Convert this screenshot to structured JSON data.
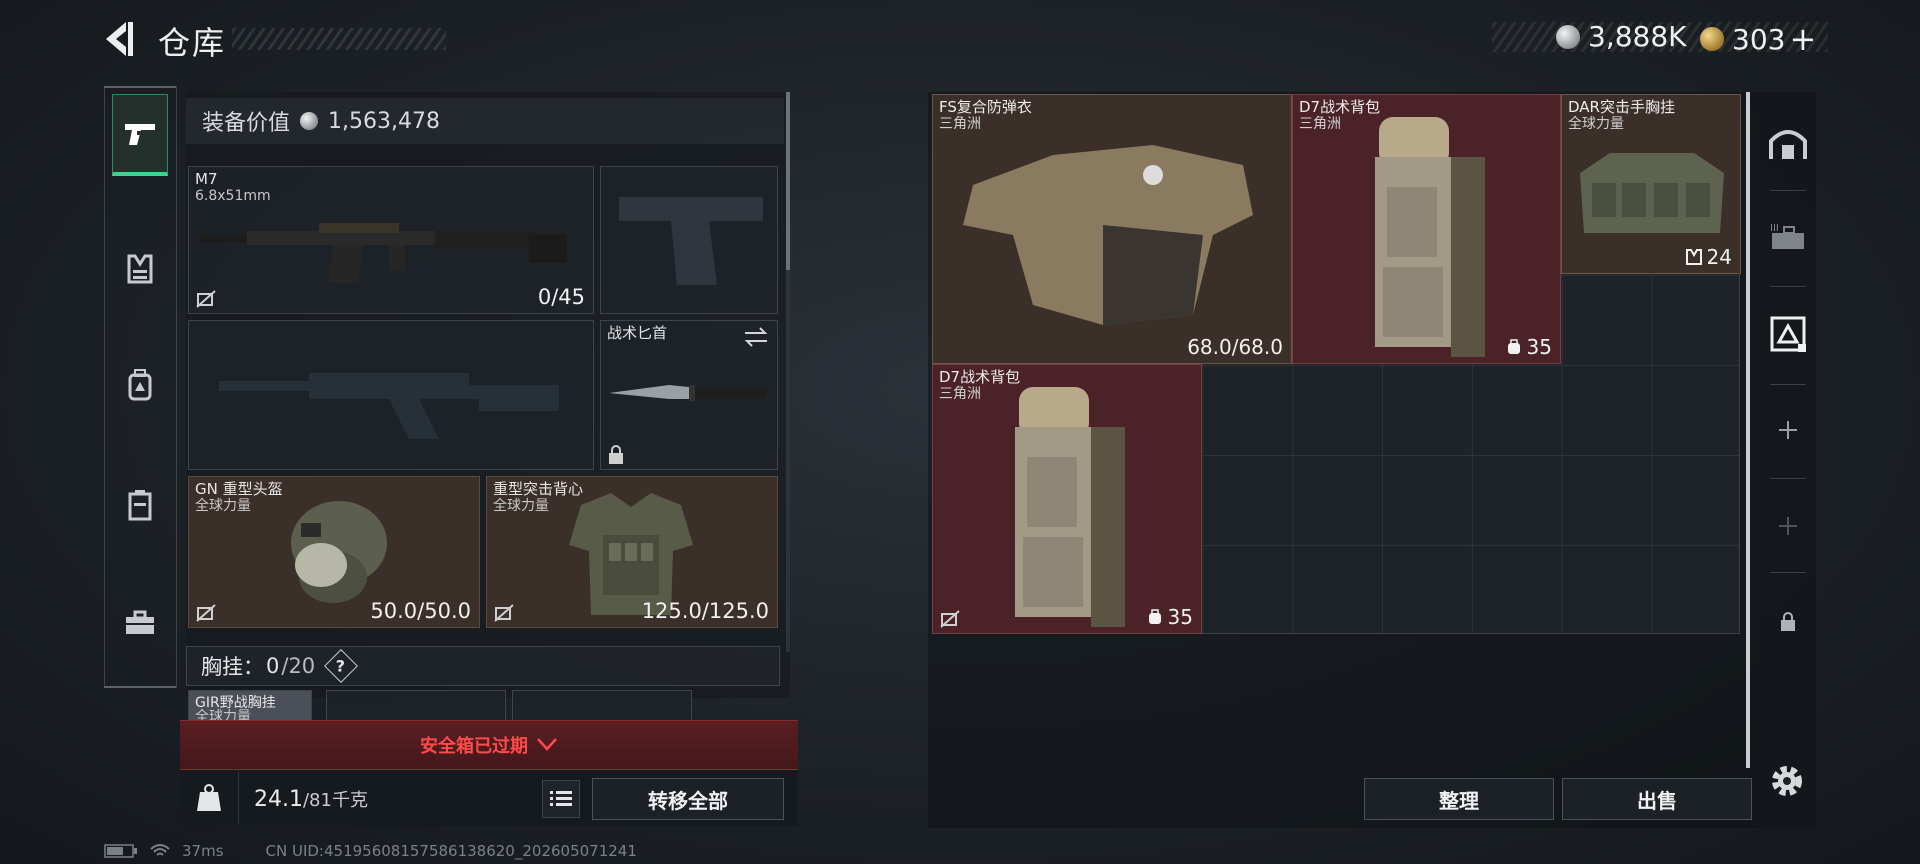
{
  "header": {
    "title": "仓库",
    "currency_silver": "3,888K",
    "currency_gold": "303",
    "gold_add": "+"
  },
  "sidebar": {
    "tabs": [
      {
        "name": "weapons",
        "icon": "pistol-icon",
        "active": true
      },
      {
        "name": "armor",
        "icon": "vest-icon"
      },
      {
        "name": "backpack",
        "icon": "backpack-icon"
      },
      {
        "name": "container",
        "icon": "case-icon"
      },
      {
        "name": "toolbox",
        "icon": "toolbox-icon"
      }
    ]
  },
  "loadout": {
    "value_label": "装备价值",
    "value": "1,563,478",
    "primary": {
      "name": "M7",
      "caliber": "6.8x51mm",
      "ammo": "0/45"
    },
    "melee": {
      "name": "战术匕首"
    },
    "helmet": {
      "name": "GN 重型头盔",
      "faction": "全球力量",
      "durability": "50.0/50.0"
    },
    "armor": {
      "name": "重型突击背心",
      "faction": "全球力量",
      "durability": "125.0/125.0"
    },
    "chest_rig": {
      "label": "胸挂：",
      "count": "0",
      "cap": "/20",
      "help": "?"
    },
    "rig_item": {
      "name": "GIR野战胸挂",
      "faction": "全球力量"
    },
    "safe_box_expired": "安全箱已过期",
    "weight": {
      "current": "24.1",
      "max": "/81千克"
    },
    "transfer_all": "转移全部"
  },
  "storage": {
    "items": [
      {
        "name": "FS复合防弹衣",
        "faction": "三角洲",
        "value": "68.0/68.0",
        "style": "brown"
      },
      {
        "name": "D7战术背包",
        "faction": "三角洲",
        "value": "35",
        "style": "red"
      },
      {
        "name": "DAR突击手胸挂",
        "faction": "全球力量",
        "value": "24",
        "style": "brown"
      },
      {
        "name": "D7战术背包",
        "faction": "三角洲",
        "value": "35",
        "style": "red"
      }
    ],
    "sort_button": "整理",
    "sell_button": "出售"
  },
  "status_bar": {
    "ping": "37ms",
    "uid": "CN UID:451956081575861386​20_202605071241"
  },
  "colors": {
    "accent_green": "#3fd18e",
    "expired_red": "#ff4a4a",
    "item_brown": "#3b2f29",
    "item_red": "#4a2227"
  }
}
